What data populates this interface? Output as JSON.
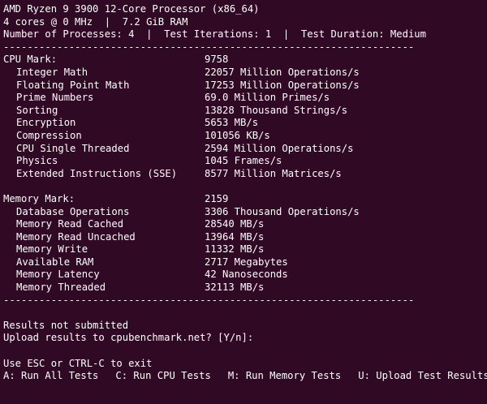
{
  "header": {
    "cpu_line": "AMD Ryzen 9 3900 12-Core Processor (x86_64)",
    "spec_line": "4 cores @ 0 MHz  |  7.2 GiB RAM",
    "config_line": "Number of Processes: 4  |  Test Iterations: 1  |  Test Duration: Medium"
  },
  "separator": "---------------------------------------------------------------------",
  "cpu": {
    "label": "CPU Mark:",
    "value": "9758",
    "items": [
      {
        "label": "Integer Math",
        "value": "22057 Million Operations/s"
      },
      {
        "label": "Floating Point Math",
        "value": "17253 Million Operations/s"
      },
      {
        "label": "Prime Numbers",
        "value": "69.0 Million Primes/s"
      },
      {
        "label": "Sorting",
        "value": "13828 Thousand Strings/s"
      },
      {
        "label": "Encryption",
        "value": "5653 MB/s"
      },
      {
        "label": "Compression",
        "value": "101056 KB/s"
      },
      {
        "label": "CPU Single Threaded",
        "value": "2594 Million Operations/s"
      },
      {
        "label": "Physics",
        "value": "1045 Frames/s"
      },
      {
        "label": "Extended Instructions (SSE)",
        "value": "8577 Million Matrices/s"
      }
    ]
  },
  "memory": {
    "label": "Memory Mark:",
    "value": "2159",
    "items": [
      {
        "label": "Database Operations",
        "value": "3306 Thousand Operations/s"
      },
      {
        "label": "Memory Read Cached",
        "value": "28540 MB/s"
      },
      {
        "label": "Memory Read Uncached",
        "value": "13964 MB/s"
      },
      {
        "label": "Memory Write",
        "value": "11332 MB/s"
      },
      {
        "label": "Available RAM",
        "value": "2717 Megabytes"
      },
      {
        "label": "Memory Latency",
        "value": "42 Nanoseconds"
      },
      {
        "label": "Memory Threaded",
        "value": "32113 MB/s"
      }
    ]
  },
  "status": {
    "submitted": "Results not submitted",
    "upload_prompt": "Upload results to cpubenchmark.net? [Y/n]:"
  },
  "footer": {
    "exit_hint": "Use ESC or CTRL-C to exit",
    "keys": [
      "A: Run All Tests",
      "C: Run CPU Tests",
      "M: Run Memory Tests",
      "U: Upload Test Results"
    ]
  },
  "colors": {
    "background": "#300a24",
    "text": "#ffffff"
  }
}
